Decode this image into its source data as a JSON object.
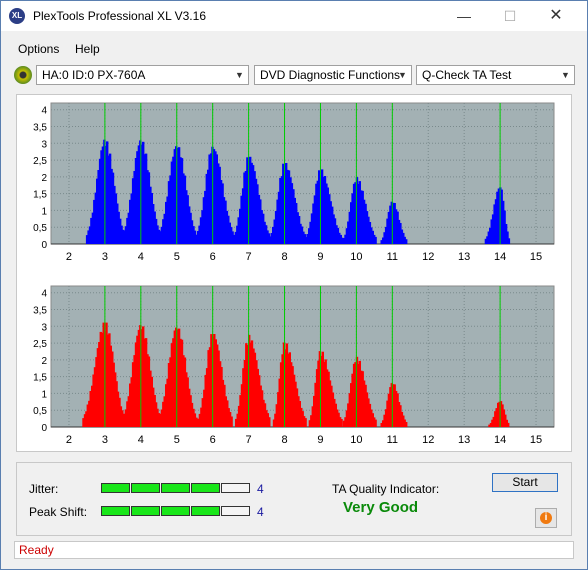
{
  "window": {
    "title": "PlexTools Professional XL V3.16",
    "icon_label": "XL",
    "min_symbol": "—",
    "max_symbol": "☐",
    "close_symbol": "✕"
  },
  "menu": [
    {
      "label": "Options"
    },
    {
      "label": "Help"
    }
  ],
  "toolbar": {
    "drive": "HA:0 ID:0  PX-760A",
    "function": "DVD Diagnostic Functions",
    "test": "Q-Check TA Test",
    "arrow": "▼"
  },
  "colors": {
    "top_bars": "#0000ff",
    "bottom_bars": "#ff0000",
    "markers": "#00cc00",
    "plot_bg": "#a3b1b4",
    "ok_meter": "#19e619",
    "quality": "#0a8a0a"
  },
  "chart_data": [
    {
      "type": "bar",
      "name": "lands",
      "color": "#0000ff",
      "xlim": [
        1.5,
        15.5
      ],
      "ylim": [
        0,
        4.2
      ],
      "xticks": [
        "2",
        "3",
        "4",
        "5",
        "6",
        "7",
        "8",
        "9",
        "10",
        "11",
        "12",
        "13",
        "14",
        "15"
      ],
      "yticks": [
        "0",
        "0,5",
        "1",
        "1,5",
        "2",
        "2,5",
        "3",
        "3,5",
        "4"
      ],
      "marker_lines": [
        3,
        4,
        5,
        6,
        7,
        8,
        9,
        10,
        11,
        14
      ],
      "peaks": [
        {
          "center": 3,
          "height": 3.15,
          "from": 2.5,
          "to": 3.55
        },
        {
          "center": 4,
          "height": 3.15,
          "from": 3.5,
          "to": 4.55
        },
        {
          "center": 5,
          "height": 3.0,
          "from": 4.5,
          "to": 5.55
        },
        {
          "center": 6,
          "height": 2.95,
          "from": 5.55,
          "to": 6.6
        },
        {
          "center": 7,
          "height": 2.65,
          "from": 6.6,
          "to": 7.6
        },
        {
          "center": 8,
          "height": 2.45,
          "from": 7.6,
          "to": 8.6
        },
        {
          "center": 9,
          "height": 2.25,
          "from": 8.6,
          "to": 9.6
        },
        {
          "center": 10,
          "height": 2.0,
          "from": 9.65,
          "to": 10.55
        },
        {
          "center": 11,
          "height": 1.3,
          "from": 10.7,
          "to": 11.4
        },
        {
          "center": 14,
          "height": 1.75,
          "from": 13.6,
          "to": 14.25
        }
      ]
    },
    {
      "type": "bar",
      "name": "pits",
      "color": "#ff0000",
      "xlim": [
        1.5,
        15.5
      ],
      "ylim": [
        0,
        4.2
      ],
      "xticks": [
        "2",
        "3",
        "4",
        "5",
        "6",
        "7",
        "8",
        "9",
        "10",
        "11",
        "12",
        "13",
        "14",
        "15"
      ],
      "yticks": [
        "0",
        "0,5",
        "1",
        "1,5",
        "2",
        "2,5",
        "3",
        "3,5",
        "4"
      ],
      "marker_lines": [
        3,
        4,
        5,
        6,
        7,
        8,
        9,
        10,
        11,
        14
      ],
      "peaks": [
        {
          "center": 3,
          "height": 3.15,
          "from": 2.4,
          "to": 3.55
        },
        {
          "center": 4,
          "height": 3.1,
          "from": 3.5,
          "to": 4.55
        },
        {
          "center": 5,
          "height": 3.05,
          "from": 4.5,
          "to": 5.55
        },
        {
          "center": 6,
          "height": 2.85,
          "from": 5.6,
          "to": 6.55
        },
        {
          "center": 7,
          "height": 2.75,
          "from": 6.65,
          "to": 7.6
        },
        {
          "center": 8,
          "height": 2.55,
          "from": 7.7,
          "to": 8.6
        },
        {
          "center": 9,
          "height": 2.3,
          "from": 8.7,
          "to": 9.6
        },
        {
          "center": 10,
          "height": 2.1,
          "from": 9.65,
          "to": 10.55
        },
        {
          "center": 11,
          "height": 1.35,
          "from": 10.7,
          "to": 11.4
        },
        {
          "center": 14,
          "height": 0.8,
          "from": 13.7,
          "to": 14.25
        }
      ]
    }
  ],
  "status": {
    "jitter_label": "Jitter:",
    "jitter_value": "4",
    "jitter_level": 4,
    "peak_shift_label": "Peak Shift:",
    "peak_shift_value": "4",
    "peak_shift_level": 4,
    "meter_max": 5,
    "quality_label": "TA Quality Indicator:",
    "quality_value": "Very Good",
    "start_label": "Start",
    "info_glyph": "i"
  },
  "statusbar": {
    "text": "Ready"
  }
}
